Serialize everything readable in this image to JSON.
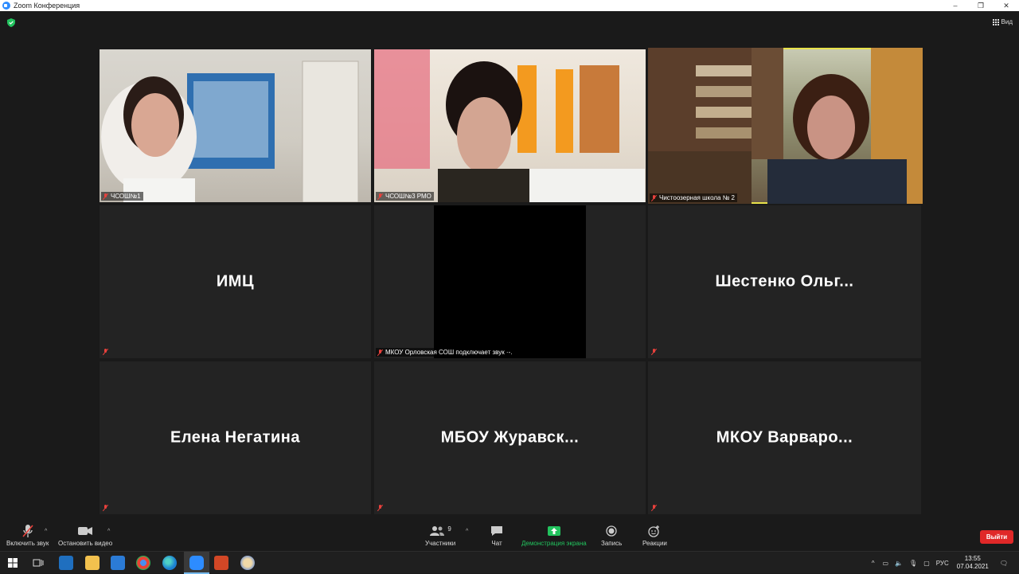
{
  "window": {
    "title": "Zoom Конференция",
    "minimize": "–",
    "maximize": "❐",
    "close": "✕"
  },
  "view_button": {
    "label": "Вид"
  },
  "tiles": [
    {
      "name": "ЧСОШ№1",
      "muted": true,
      "video": true
    },
    {
      "name": "ЧСОШ№3 РМО",
      "muted": true,
      "video": true
    },
    {
      "name": "Чистоозерная школа № 2",
      "muted": true,
      "video": true,
      "active_speaker": true
    },
    {
      "name": "ИМЦ",
      "muted": true,
      "video": false
    },
    {
      "name": "МКОУ Орловская СОШ подключает звук ·-.",
      "muted": true,
      "video": true
    },
    {
      "name": "Шестенко  Ольг...",
      "muted": true,
      "video": false
    },
    {
      "name": "Елена Негатина",
      "muted": true,
      "video": false
    },
    {
      "name": "МБОУ  Журавск...",
      "muted": true,
      "video": false
    },
    {
      "name": "МКОУ  Варваро...",
      "muted": true,
      "video": false
    }
  ],
  "toolbar": {
    "unmute": "Включить звук",
    "stop_video": "Остановить видео",
    "participants": "Участники",
    "participants_count": "9",
    "chat": "Чат",
    "share_screen": "Демонстрация экрана",
    "record": "Запись",
    "reactions": "Реакции",
    "leave": "Выйти"
  },
  "taskbar": {
    "language": "РУС",
    "time": "13:55",
    "date": "07.04.2021"
  },
  "colors": {
    "accent": "#2d8cff",
    "active_speaker": "#e8e24a",
    "leave": "#e02828",
    "muted": "#e8413c",
    "share_green": "#22c35e"
  }
}
